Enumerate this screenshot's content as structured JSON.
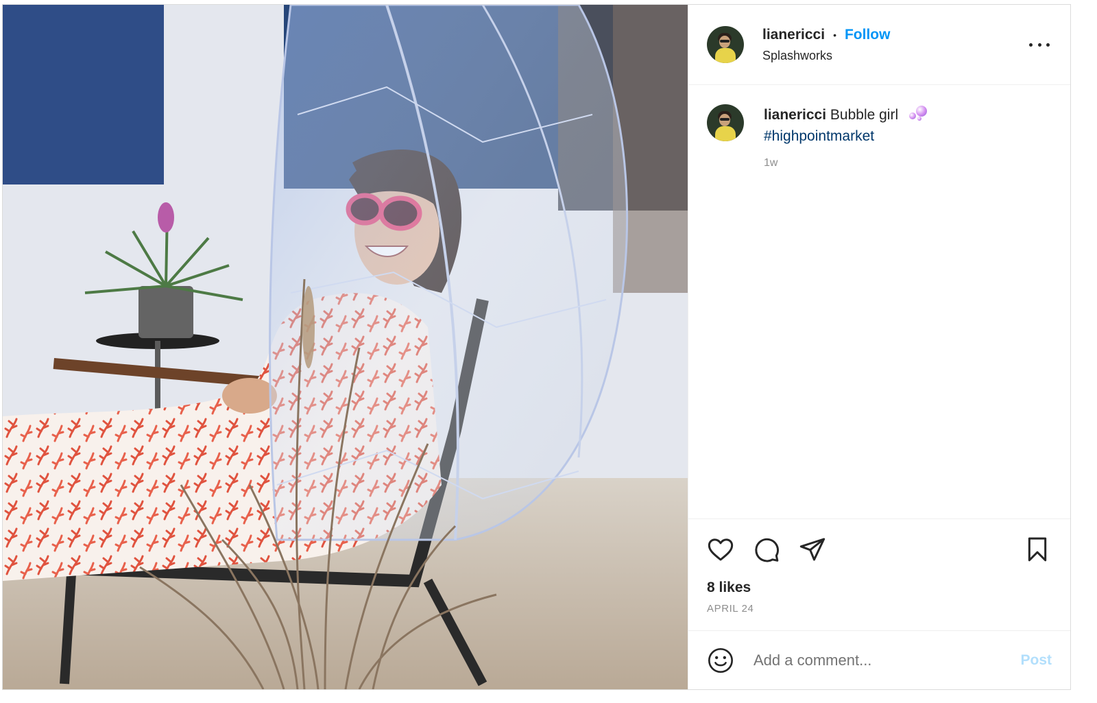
{
  "post": {
    "image_alt": "Woman in red sunglasses and red-and-white leaf print dress sitting in a clear bubble chair",
    "header": {
      "username": "lianericci",
      "separator": "•",
      "follow_label": "Follow",
      "location": "Splashworks",
      "more_icon": "more-horizontal-icon"
    },
    "caption": {
      "username": "lianericci",
      "text": "Bubble girl",
      "hashtag": "#highpointmarket",
      "time": "1w"
    },
    "actions": {
      "like_icon": "heart-icon",
      "comment_icon": "comment-bubble-icon",
      "share_icon": "paper-plane-icon",
      "save_icon": "bookmark-icon"
    },
    "likes": "8 likes",
    "date": "APRIL 24",
    "comment_box": {
      "emoji_icon": "smiley-icon",
      "placeholder": "Add a comment...",
      "post_label": "Post"
    },
    "colors": {
      "link_blue": "#0095f6",
      "hashtag_blue": "#00376b",
      "post_disabled": "#b2dffc",
      "muted_text": "#8e8e8e"
    }
  }
}
